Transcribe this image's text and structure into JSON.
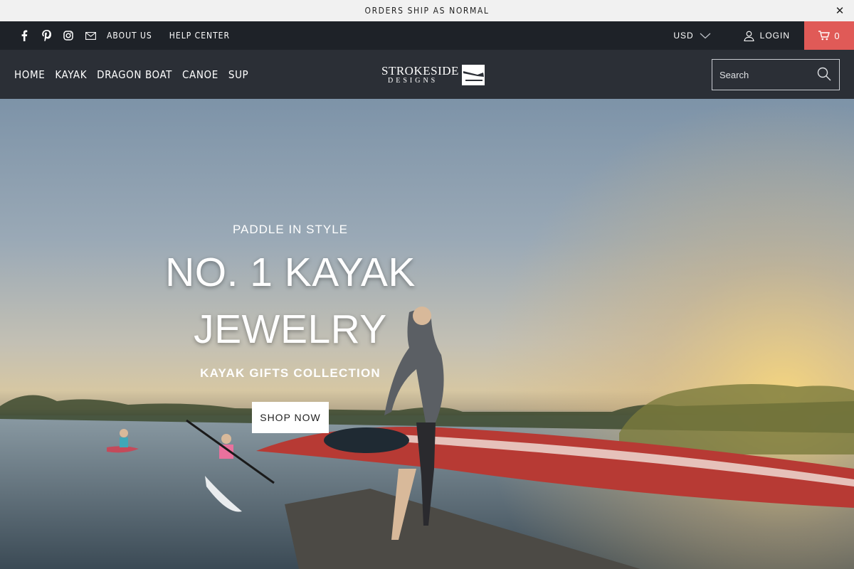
{
  "announcement": {
    "text": "ORDERS SHIP AS NORMAL",
    "close_icon": "close-icon"
  },
  "utility": {
    "social_icons": [
      "facebook-icon",
      "pinterest-icon",
      "instagram-icon",
      "email-icon"
    ],
    "links": [
      "ABOUT US",
      "HELP CENTER"
    ],
    "currency": "USD",
    "login": "LOGIN",
    "cart_count": "0",
    "cart_color": "#e05a57"
  },
  "header": {
    "nav": [
      "HOME",
      "KAYAK",
      "DRAGON BOAT",
      "CANOE",
      "SUP"
    ],
    "logo_top": "STROKESIDE",
    "logo_bottom": "DESIGNS",
    "search_placeholder": "Search"
  },
  "hero": {
    "eyebrow": "PADDLE IN STYLE",
    "headline_line1": "NO. 1 KAYAK",
    "headline_line2": "JEWELRY",
    "subhead": "KAYAK GIFTS COLLECTION",
    "cta": "SHOP NOW"
  }
}
